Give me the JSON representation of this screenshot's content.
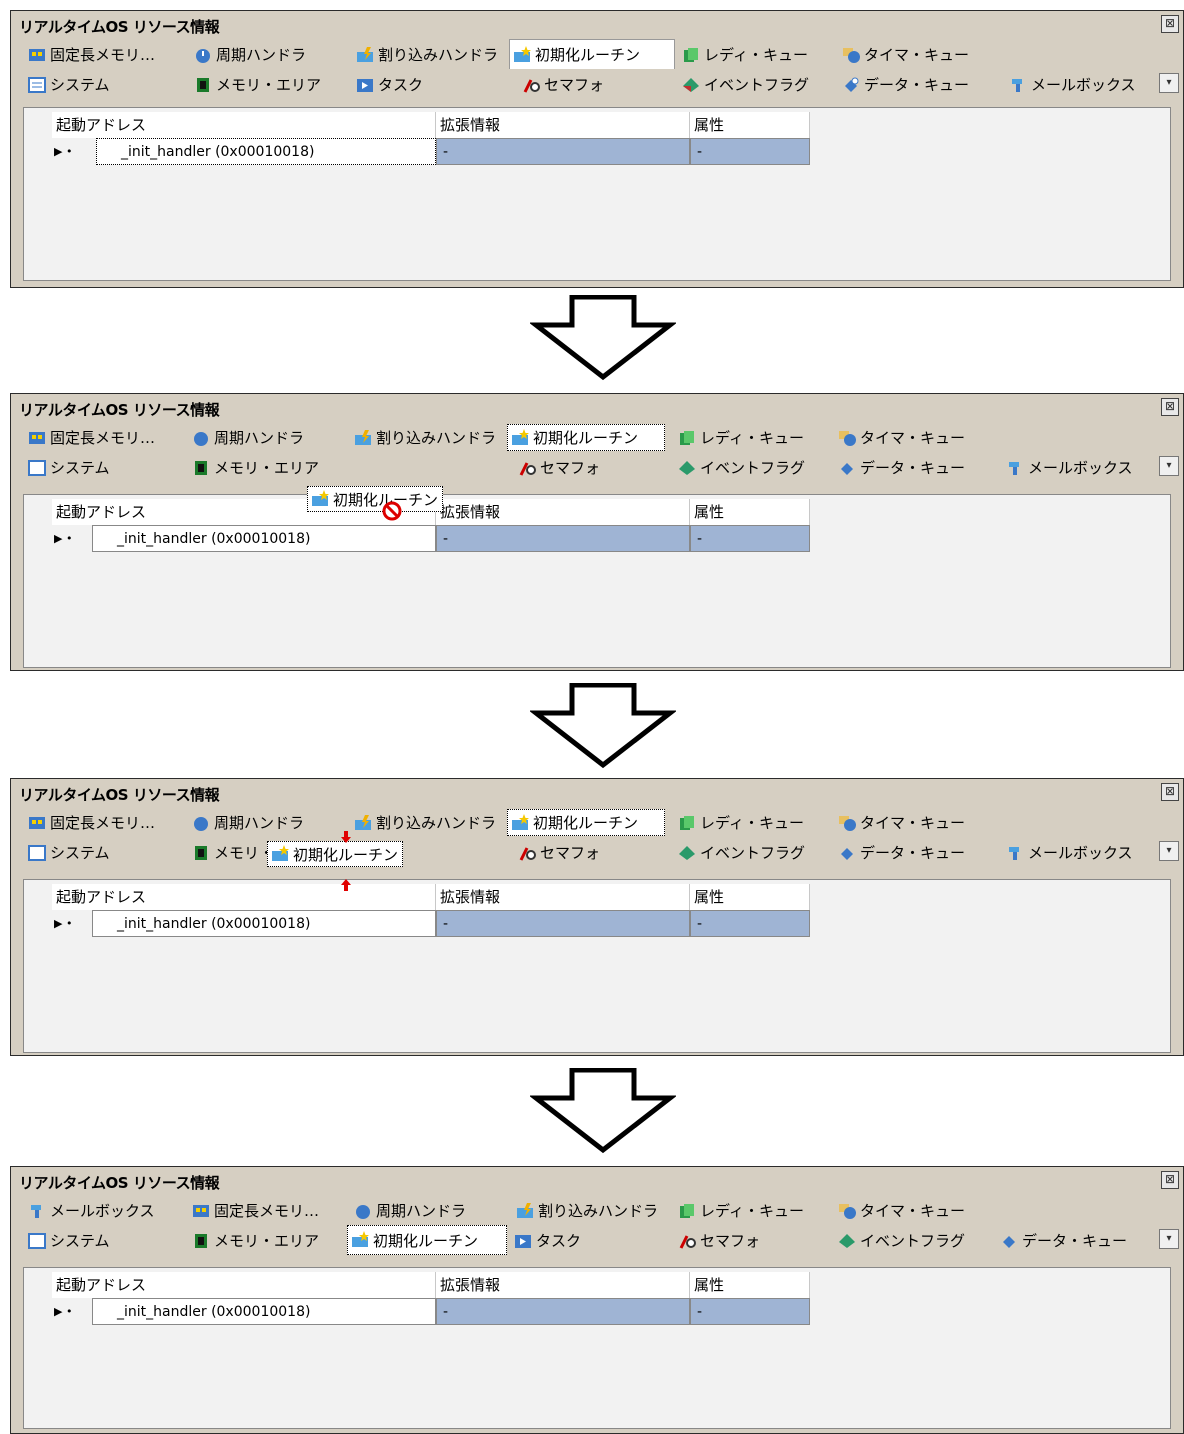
{
  "window_title": "リアルタイムOS リソース情報",
  "close_glyph": "⊠",
  "dropdown_glyph": "▾",
  "columns": {
    "address": "起動アドレス",
    "ext": "拡張情報",
    "attr": "属性"
  },
  "row": {
    "arrow": "▶ •",
    "name": "_init_handler (0x00010018)",
    "ext": "-",
    "attr": "-"
  },
  "tabs": {
    "fixed_mem": "固定長メモリ…",
    "cyclic": "周期ハンドラ",
    "interrupt": "割り込みハンドラ",
    "init_routine": "初期化ルーチン",
    "ready_queue": "レディ・キュー",
    "timer_queue": "タイマ・キュー",
    "system": "システム",
    "mem_area": "メモリ・エリア",
    "task": "タスク",
    "semaphore": "セマフォ",
    "event_flag": "イベントフラグ",
    "data_queue": "データ・キュー",
    "mailbox": "メールボックス"
  },
  "drag": {
    "ghost_label": "初期化ルーチン",
    "no_drop_icon": "no-drop-icon"
  },
  "colors": {
    "selected_cell": "#9fb4d4",
    "panel_bg": "#d6cfc2",
    "drop_marker": "#e00000"
  }
}
